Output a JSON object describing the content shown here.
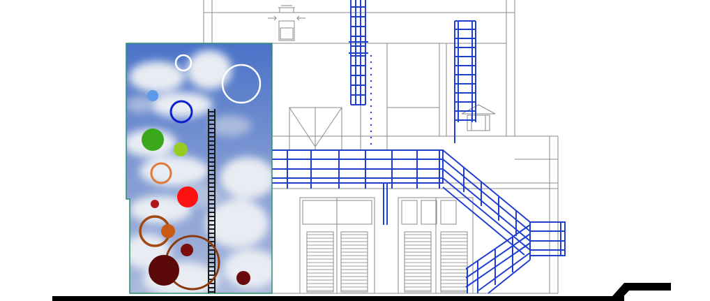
{
  "drawing": {
    "type": "architectural-elevation",
    "colors": {
      "background": "#ffffff",
      "linework": "#8a8a8a",
      "linework_dark": "#555555",
      "steel": "#1f3fd1",
      "ground": "#000000",
      "panel_border": "#2f8f6a",
      "sky_top": "#4a72c8",
      "sky_mid": "#8fa6d8",
      "cloud": "#e8ecf2",
      "ladder": "#1a1a1a"
    },
    "circles": [
      {
        "kind": "ring",
        "color": "#ffffff"
      },
      {
        "kind": "ring",
        "color": "#ffffff"
      },
      {
        "kind": "dot",
        "color": "#5a9ae8"
      },
      {
        "kind": "ring",
        "color": "#0a1fd0"
      },
      {
        "kind": "dot",
        "color": "#3aa81a"
      },
      {
        "kind": "dot",
        "color": "#96cc22"
      },
      {
        "kind": "ring",
        "color": "#e07a3a"
      },
      {
        "kind": "dot",
        "color": "#ff1010"
      },
      {
        "kind": "dot",
        "color": "#b01818"
      },
      {
        "kind": "ring",
        "color": "#a04a12"
      },
      {
        "kind": "dot",
        "color": "#c85a14"
      },
      {
        "kind": "dot",
        "color": "#7a0e0e"
      },
      {
        "kind": "ring",
        "color": "#8a3a0a"
      },
      {
        "kind": "dot",
        "color": "#5a0808"
      },
      {
        "kind": "dot",
        "color": "#6a0a0a"
      }
    ]
  }
}
